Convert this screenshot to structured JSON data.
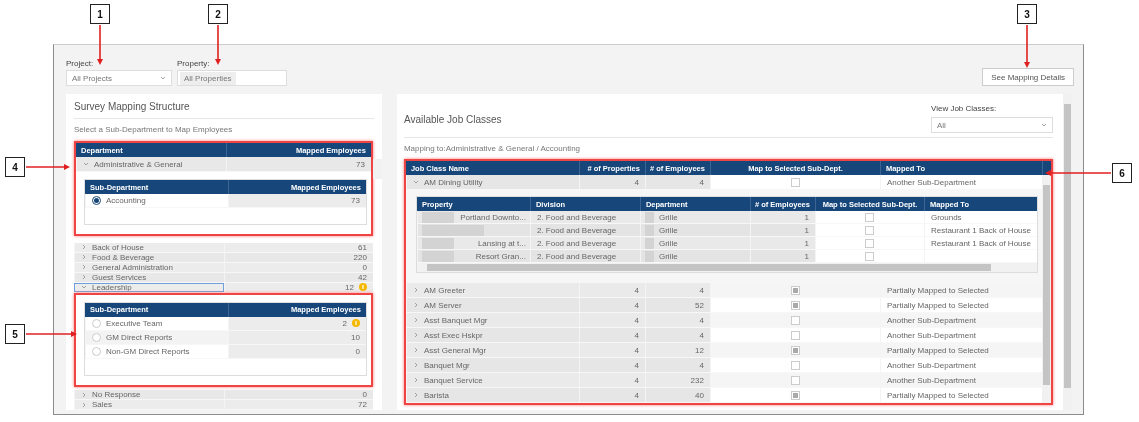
{
  "callouts": [
    {
      "label": "1"
    },
    {
      "label": "2"
    },
    {
      "label": "3"
    },
    {
      "label": "4"
    },
    {
      "label": "5"
    },
    {
      "label": "6"
    }
  ],
  "filters": {
    "project": {
      "label": "Project:",
      "value": "All Projects"
    },
    "property": {
      "label": "Property:",
      "value": "All Properties"
    }
  },
  "mapping_details_button": "See Mapping Details",
  "survey_panel": {
    "title": "Survey Mapping Structure",
    "subtitle": "Select a Sub-Department to Map Employees",
    "columns": [
      "Department",
      "Mapped Employees"
    ],
    "departments": [
      {
        "name": "Administrative & General",
        "count": "73",
        "expanded": true,
        "focused": false,
        "warning": false,
        "highlighted": true,
        "sub_columns": [
          "Sub-Department",
          "Mapped Employees"
        ],
        "children": [
          {
            "name": "Accounting",
            "count": "73",
            "selected": true,
            "warning": false
          }
        ]
      },
      {
        "name": "Back of House",
        "count": "61",
        "expanded": false,
        "focused": false,
        "warning": false,
        "highlighted": false
      },
      {
        "name": "Food & Beverage",
        "count": "220",
        "expanded": false,
        "focused": false,
        "warning": false,
        "highlighted": false
      },
      {
        "name": "General Administration",
        "count": "0",
        "expanded": false,
        "focused": false,
        "warning": false,
        "highlighted": false
      },
      {
        "name": "Guest Services",
        "count": "42",
        "expanded": false,
        "focused": false,
        "warning": false,
        "highlighted": false
      },
      {
        "name": "Leadership",
        "count": "12",
        "expanded": true,
        "focused": true,
        "warning": true,
        "highlighted": false,
        "children_highlighted": true,
        "sub_columns": [
          "Sub-Department",
          "Mapped Employees"
        ],
        "children": [
          {
            "name": "Executive Team",
            "count": "2",
            "selected": false,
            "warning": true
          },
          {
            "name": "GM Direct Reports",
            "count": "10",
            "selected": false,
            "warning": false
          },
          {
            "name": "Non-GM Direct Reports",
            "count": "0",
            "selected": false,
            "warning": false
          }
        ]
      },
      {
        "name": "No Response",
        "count": "0",
        "expanded": false,
        "focused": false,
        "warning": false,
        "highlighted": false
      },
      {
        "name": "Sales",
        "count": "72",
        "expanded": false,
        "focused": false,
        "warning": false,
        "highlighted": false
      }
    ]
  },
  "job_panel": {
    "title": "Available Job Classes",
    "view_job_classes": {
      "label": "View Job Classes:",
      "value": "All"
    },
    "mapping_to": "Mapping to:Administrative & General / Accounting",
    "highlighted": true,
    "columns": [
      "Job Class Name",
      "# of Properties",
      "# of Employees",
      "Map to Selected Sub-Dept.",
      "Mapped To"
    ],
    "detail_columns": [
      "Property",
      "Division",
      "Department",
      "# of Employees",
      "Map to Selected Sub-Dept.",
      "Mapped To"
    ],
    "rows": [
      {
        "name": "AM Dining Utility",
        "properties": "4",
        "employees": "4",
        "partially_mapped": false,
        "mapped_to": "Another Sub-Department",
        "expanded": true,
        "details": [
          {
            "property": "Portland Downto...",
            "redacted": true,
            "division": "2. Food and Beverage",
            "department": "Grille",
            "employees": "1",
            "checked": false,
            "mapped_to": "Grounds"
          },
          {
            "redacted": true,
            "division": "2. Food and Beverage",
            "department": "Grille",
            "employees": "1",
            "checked": false,
            "mapped_to": "Restaurant 1 Back of House"
          },
          {
            "property": "Lansing at t...",
            "redacted": true,
            "division": "2. Food and Beverage",
            "department": "Grille",
            "employees": "1",
            "checked": false,
            "mapped_to": "Restaurant 1 Back of House"
          },
          {
            "property": "Resort Gran...",
            "redacted": true,
            "division": "2. Food and Beverage",
            "department": "Grille",
            "employees": "1",
            "checked": false
          }
        ]
      },
      {
        "name": "AM Greeter",
        "properties": "4",
        "employees": "4",
        "partially_mapped": true,
        "mapped_to": "Partially Mapped to Selected",
        "expanded": false
      },
      {
        "name": "AM Server",
        "properties": "4",
        "employees": "52",
        "partially_mapped": true,
        "mapped_to": "Partially Mapped to Selected",
        "expanded": false
      },
      {
        "name": "Asst Banquet Mgr",
        "properties": "4",
        "employees": "4",
        "partially_mapped": false,
        "mapped_to": "Another Sub-Department",
        "expanded": false
      },
      {
        "name": "Asst Exec Hskpr",
        "properties": "4",
        "employees": "4",
        "partially_mapped": false,
        "mapped_to": "Another Sub-Department",
        "expanded": false
      },
      {
        "name": "Asst General Mgr",
        "properties": "4",
        "employees": "12",
        "partially_mapped": true,
        "mapped_to": "Partially Mapped to Selected",
        "expanded": false
      },
      {
        "name": "Banquet Mgr",
        "properties": "4",
        "employees": "4",
        "partially_mapped": false,
        "mapped_to": "Another Sub-Department",
        "expanded": false
      },
      {
        "name": "Banquet Service",
        "properties": "4",
        "employees": "232",
        "partially_mapped": false,
        "mapped_to": "Another Sub-Department",
        "expanded": false
      },
      {
        "name": "Barista",
        "properties": "4",
        "employees": "40",
        "partially_mapped": true,
        "mapped_to": "Partially Mapped to Selected",
        "expanded": false
      }
    ]
  }
}
